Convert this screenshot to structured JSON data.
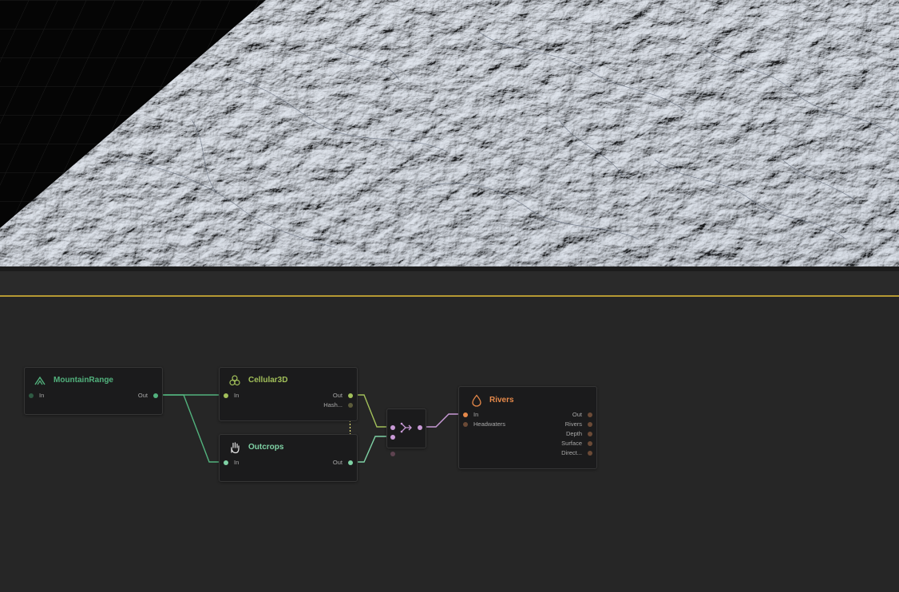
{
  "viewport": {
    "label": ""
  },
  "colors": {
    "mountain": "#52b27d",
    "cellular": "#a2c05a",
    "outcrops": "#7fd2a5",
    "merge": "#c89ad6",
    "rivers": "#e6894a",
    "active_line": "#b69a33"
  },
  "nodes": {
    "mountain_range": {
      "icon": "mountain-icon",
      "title": "MountainRange",
      "in": "In",
      "out": "Out"
    },
    "cellular3d": {
      "icon": "cells-icon",
      "title": "Cellular3D",
      "in": "In",
      "out": "Out",
      "out2": "Hash..."
    },
    "outcrops": {
      "icon": "hand-icon",
      "title": "Outcrops",
      "in": "In",
      "out": "Out"
    },
    "combine": {
      "icon": "merge-icon"
    },
    "rivers": {
      "icon": "droplet-icon",
      "title": "Rivers",
      "inputs": [
        "In",
        "Headwaters"
      ],
      "outputs": [
        "Out",
        "Rivers",
        "Depth",
        "Surface",
        "Direct..."
      ]
    }
  }
}
